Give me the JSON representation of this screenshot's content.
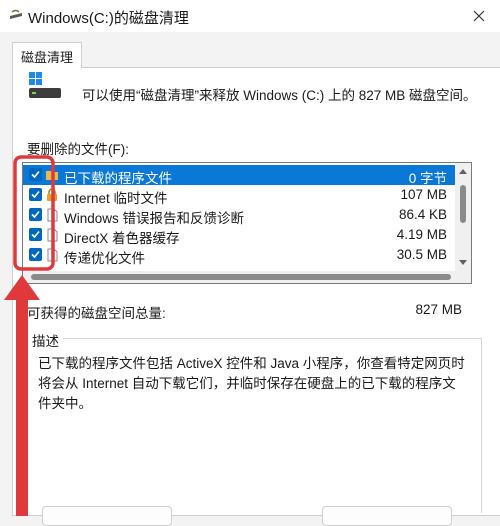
{
  "window": {
    "title": "Windows(C:)的磁盘清理"
  },
  "tabs": [
    {
      "label": "磁盘清理"
    }
  ],
  "intro": {
    "text": "可以使用“磁盘清理”来释放 Windows (C:) 上的 827 MB 磁盘空间。"
  },
  "files": {
    "label": "要删除的文件(F):",
    "rows": [
      {
        "name": "已下载的程序文件",
        "size": "0 字节",
        "checked": true,
        "selected": true,
        "icon": "folder-icon"
      },
      {
        "name": "Internet 临时文件",
        "size": "107 MB",
        "checked": true,
        "selected": false,
        "icon": "lock-icon"
      },
      {
        "name": "Windows 错误报告和反馈诊断",
        "size": "86.4 KB",
        "checked": true,
        "selected": false,
        "icon": "document-icon"
      },
      {
        "name": "DirectX 着色器缓存",
        "size": "4.19 MB",
        "checked": true,
        "selected": false,
        "icon": "document-icon"
      },
      {
        "name": "传递优化文件",
        "size": "30.5 MB",
        "checked": true,
        "selected": false,
        "icon": "document-icon"
      }
    ]
  },
  "space_gained": {
    "label": "可获得的磁盘空间总量:",
    "value": "827 MB"
  },
  "description": {
    "title": "描述",
    "text": "已下载的程序文件包括 ActiveX 控件和 Java 小程序，你查看特定网页时将会从 Internet 自动下载它们，并临时保存在硬盘上的已下载的程序文件夹中。"
  },
  "colors": {
    "accent": "#0a78d7",
    "checkbox": "#0067c0",
    "annotation": "#e0393b"
  }
}
